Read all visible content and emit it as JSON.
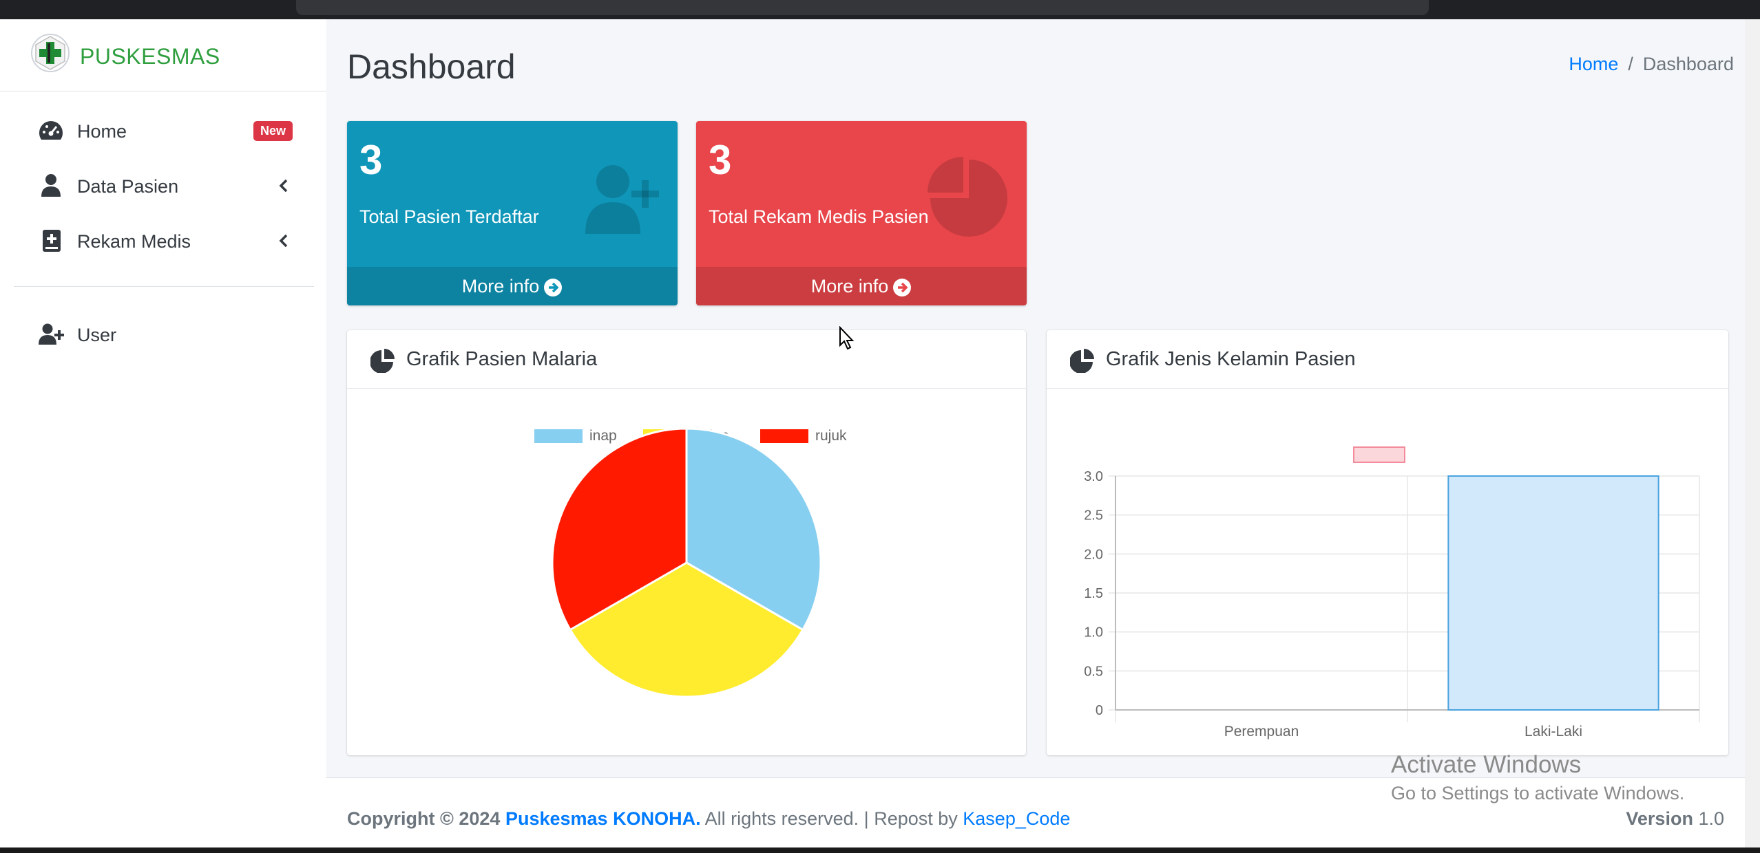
{
  "brand": {
    "name": "PUSKESMAS"
  },
  "nav": {
    "home": "Home",
    "home_badge": "New",
    "data_pasien": "Data Pasien",
    "rekam_medis": "Rekam Medis",
    "user": "User"
  },
  "header": {
    "title": "Dashboard",
    "breadcrumb": [
      "Home",
      "Dashboard"
    ]
  },
  "stats": [
    {
      "value": "3",
      "label": "Total Pasien Terdaftar",
      "more": "More info",
      "color": "#0f96b8"
    },
    {
      "value": "3",
      "label": "Total Rekam Medis Pasien",
      "more": "More info",
      "color": "#e8464b"
    }
  ],
  "cards": {
    "malaria_title": "Grafik Pasien Malaria",
    "gender_title": "Grafik Jenis Kelamin Pasien"
  },
  "chart_data": [
    {
      "type": "pie",
      "title": "Grafik Pasien Malaria",
      "labels": [
        "inap",
        "jalan",
        "rujuk"
      ],
      "values": [
        1,
        1,
        1
      ],
      "colors": [
        "#87cff0",
        "#ffec2e",
        "#ff1a00"
      ],
      "legend": "top"
    },
    {
      "type": "bar",
      "title": "Grafik Jenis Kelamin Pasien",
      "categories": [
        "Perempuan",
        "Laki-Laki"
      ],
      "series": [
        {
          "values": [
            0,
            3
          ],
          "color": "#d2e8fb"
        }
      ],
      "ylim": [
        0,
        3
      ],
      "yticks": [
        "3.0",
        "2.5",
        "2.0",
        "1.5",
        "1.0",
        "0.5",
        "0"
      ],
      "grid": true,
      "legend": "top"
    }
  ],
  "footer": {
    "copyright_prefix": "Copyright © 2024",
    "copyright_brand": "Puskesmas KONOHA.",
    "copyright_rest": "All rights reserved. | Repost by",
    "repost": "Kasep_Code",
    "version_label": "Version",
    "version_value": "1.0"
  },
  "watermark": {
    "line1": "Activate Windows",
    "line2": "Go to Settings to activate Windows."
  }
}
